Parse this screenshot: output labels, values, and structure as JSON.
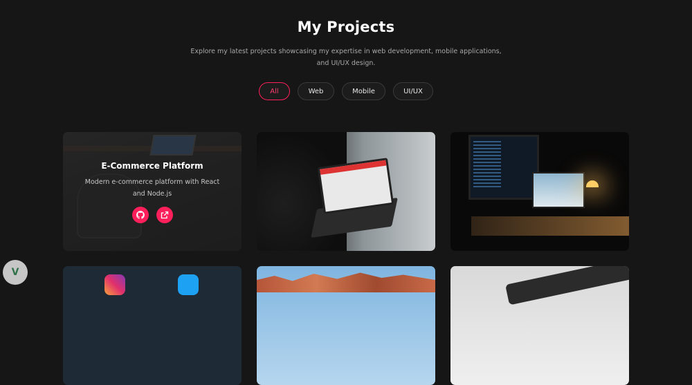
{
  "header": {
    "title": "My Projects",
    "subtitle": "Explore my latest projects showcasing my expertise in web development, mobile applications, and UI/UX design."
  },
  "filters": [
    {
      "label": "All",
      "active": true
    },
    {
      "label": "Web",
      "active": false
    },
    {
      "label": "Mobile",
      "active": false
    },
    {
      "label": "UI/UX",
      "active": false
    }
  ],
  "projects": [
    {
      "title": "E-Commerce Platform",
      "description": "Modern e-commerce platform with React and Node.js",
      "icons": [
        "github-icon",
        "external-link-icon"
      ]
    }
  ],
  "badge": {
    "icon": "v-logo-icon",
    "text": "V"
  },
  "colors": {
    "accent": "#ff1f5a",
    "background": "#161616"
  }
}
